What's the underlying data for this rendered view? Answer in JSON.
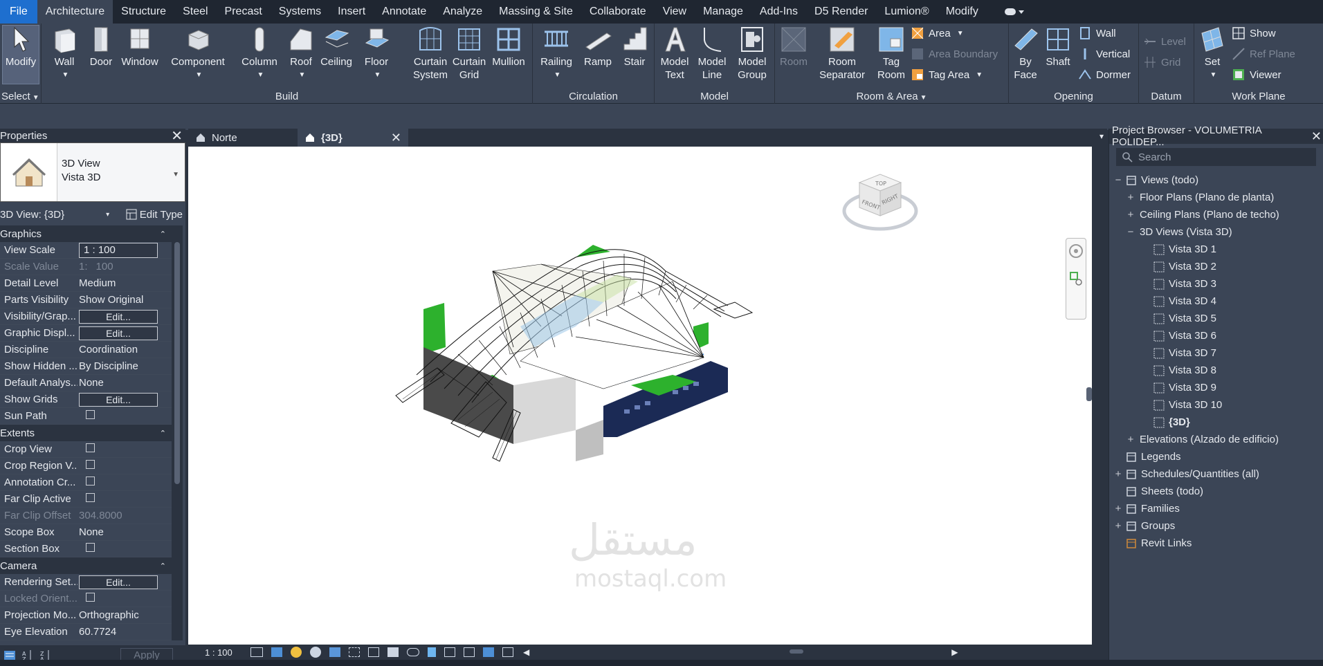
{
  "menu": [
    "File",
    "Architecture",
    "Structure",
    "Steel",
    "Precast",
    "Systems",
    "Insert",
    "Annotate",
    "Analyze",
    "Massing & Site",
    "Collaborate",
    "View",
    "Manage",
    "Add-Ins",
    "D5 Render",
    "Lumion®",
    "Modify"
  ],
  "ribbon": {
    "select": {
      "modify": "Modify",
      "select_label": "Select"
    },
    "build": {
      "label": "Build",
      "wall": "Wall",
      "door": "Door",
      "window": "Window",
      "component": "Component",
      "column": "Column",
      "roof": "Roof",
      "ceiling": "Ceiling",
      "floor": "Floor",
      "curtain_system": [
        "Curtain",
        "System"
      ],
      "curtain_grid": [
        "Curtain",
        "Grid"
      ],
      "mullion": "Mullion"
    },
    "circulation": {
      "label": "Circulation",
      "railing": "Railing",
      "ramp": "Ramp",
      "stair": "Stair"
    },
    "model": {
      "label": "Model",
      "model_text": [
        "Model",
        "Text"
      ],
      "model_line": [
        "Model",
        "Line"
      ],
      "model_group": [
        "Model",
        "Group"
      ]
    },
    "room_area": {
      "label": "Room & Area",
      "room": "Room",
      "room_separator": [
        "Room",
        "Separator"
      ],
      "tag_room": [
        "Tag",
        "Room"
      ],
      "area": "Area",
      "area_boundary": "Area  Boundary",
      "tag_area": "Tag  Area"
    },
    "opening": {
      "label": "Opening",
      "by_face": [
        "By",
        "Face"
      ],
      "shaft": "Shaft",
      "wall": "Wall",
      "vertical": "Vertical",
      "dormer": "Dormer"
    },
    "datum": {
      "label": "Datum",
      "level": "Level",
      "grid": "Grid"
    },
    "work_plane": {
      "label": "Work Plane",
      "set": "Set",
      "show": "Show",
      "ref_plane": "Ref  Plane",
      "viewer": "Viewer"
    }
  },
  "properties": {
    "title": "Properties",
    "type_name": [
      "3D View",
      "Vista 3D"
    ],
    "instance_selector": "3D View: {3D}",
    "edit_type": "Edit Type",
    "sections": {
      "graphics": "Graphics",
      "extents": "Extents",
      "camera": "Camera"
    },
    "graphics_rows": [
      {
        "name": "View Scale",
        "value": "1 : 100"
      },
      {
        "name": "Scale Value",
        "prefix": "1:",
        "value": "100"
      },
      {
        "name": "Detail Level",
        "value": "Medium"
      },
      {
        "name": "Parts Visibility",
        "value": "Show Original"
      },
      {
        "name": "Visibility/Grap...",
        "value": "Edit..."
      },
      {
        "name": "Graphic Displ...",
        "value": "Edit..."
      },
      {
        "name": "Discipline",
        "value": "Coordination"
      },
      {
        "name": "Show Hidden ...",
        "value": "By Discipline"
      },
      {
        "name": "Default Analys...",
        "value": "None"
      },
      {
        "name": "Show Grids",
        "value": "Edit..."
      },
      {
        "name": "Sun Path",
        "value": ""
      }
    ],
    "extents_rows": [
      {
        "name": "Crop View",
        "value": ""
      },
      {
        "name": "Crop Region V...",
        "value": ""
      },
      {
        "name": "Annotation Cr...",
        "value": ""
      },
      {
        "name": "Far Clip Active",
        "value": ""
      },
      {
        "name": "Far Clip Offset",
        "value": "304.8000"
      },
      {
        "name": "Scope Box",
        "value": "None"
      },
      {
        "name": "Section Box",
        "value": ""
      }
    ],
    "camera_rows": [
      {
        "name": "Rendering Set...",
        "value": "Edit..."
      },
      {
        "name": "Locked Orient...",
        "value": ""
      },
      {
        "name": "Projection Mo...",
        "value": "Orthographic"
      },
      {
        "name": "Eye Elevation",
        "value": "60.7724"
      }
    ],
    "apply": "Apply"
  },
  "tabs": [
    {
      "label": "Norte"
    },
    {
      "label": "{3D}"
    }
  ],
  "viewbar": {
    "scale": "1 : 100"
  },
  "viewcube": {
    "top": "TOP",
    "front": "FRONT",
    "right": "RIGHT"
  },
  "watermark": {
    "arabic": "مستقل",
    "latin": "mostaql.com"
  },
  "browser": {
    "title": "Project Browser - VOLUMETRIA POLIDEP...",
    "search_placeholder": "Search",
    "tree": [
      {
        "label": "Views (todo)",
        "level": 0,
        "exp": "−"
      },
      {
        "label": "Floor Plans (Plano de planta)",
        "level": 1,
        "exp": "+"
      },
      {
        "label": "Ceiling Plans (Plano de techo)",
        "level": 1,
        "exp": "+"
      },
      {
        "label": "3D Views (Vista 3D)",
        "level": 1,
        "exp": "−"
      },
      {
        "label": "Vista 3D 1",
        "level": 2
      },
      {
        "label": "Vista 3D 2",
        "level": 2
      },
      {
        "label": "Vista 3D 3",
        "level": 2
      },
      {
        "label": "Vista 3D 4",
        "level": 2
      },
      {
        "label": "Vista 3D 5",
        "level": 2
      },
      {
        "label": "Vista 3D 6",
        "level": 2
      },
      {
        "label": "Vista 3D 7",
        "level": 2
      },
      {
        "label": "Vista 3D 8",
        "level": 2
      },
      {
        "label": "Vista 3D 9",
        "level": 2
      },
      {
        "label": "Vista 3D 10",
        "level": 2
      },
      {
        "label": "{3D}",
        "level": 2,
        "bold": true
      },
      {
        "label": "Elevations (Alzado de edificio)",
        "level": 1,
        "exp": "+"
      },
      {
        "label": "Legends",
        "level": 0
      },
      {
        "label": "Schedules/Quantities (all)",
        "level": 0,
        "exp": "+"
      },
      {
        "label": "Sheets (todo)",
        "level": 0
      },
      {
        "label": "Families",
        "level": 0,
        "exp": "+"
      },
      {
        "label": "Groups",
        "level": 0,
        "exp": "+"
      },
      {
        "label": "Revit Links",
        "level": 0
      }
    ]
  },
  "colors": {
    "accent": "#1e6fcf",
    "ribbon": "#3b4556",
    "panel": "#2b3340"
  }
}
